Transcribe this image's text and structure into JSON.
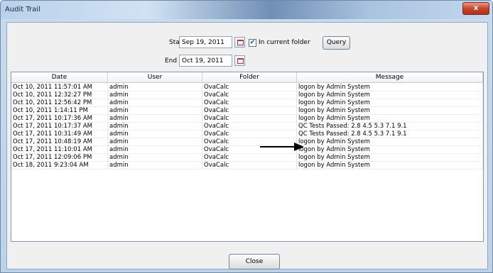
{
  "window": {
    "title": "Audit Trail",
    "close_glyph": "x"
  },
  "filters": {
    "start_label": "Start",
    "start_value": "Sep 19, 2011",
    "end_label": "End",
    "end_value": "Oct 19, 2011",
    "in_folder_label": "In current folder",
    "in_folder_checked": true,
    "query_label": "Query"
  },
  "table": {
    "columns": [
      "Date",
      "User",
      "Folder",
      "Message"
    ],
    "rows": [
      [
        "Oct 10, 2011 11:57:01 AM",
        "admin",
        "OvaCalc",
        "logon by Admin System"
      ],
      [
        "Oct 10, 2011 12:32:27 PM",
        "admin",
        "OvaCalc",
        "logon by Admin System"
      ],
      [
        "Oct 10, 2011 12:56:42 PM",
        "admin",
        "OvaCalc",
        "logon by Admin System"
      ],
      [
        "Oct 10, 2011 1:14:11 PM",
        "admin",
        "OvaCalc",
        "logon by Admin System"
      ],
      [
        "Oct 17, 2011 10:17:36 AM",
        "admin",
        "OvaCalc",
        "logon by Admin System"
      ],
      [
        "Oct 17, 2011 10:17:37 AM",
        "admin",
        "OvaCalc",
        "QC Tests Passed: 2.8 4.5 5.3 7.1 9.1"
      ],
      [
        "Oct 17, 2011 10:31:49 AM",
        "admin",
        "OvaCalc",
        "QC Tests Passed: 2.8 4.5 5.3 7.1 9.1"
      ],
      [
        "Oct 17, 2011 10:48:19 AM",
        "admin",
        "OvaCalc",
        "logon by Admin System"
      ],
      [
        "Oct 17, 2011 11:10:01 AM",
        "admin",
        "OvaCalc",
        "logon by Admin System"
      ],
      [
        "Oct 17, 2011 12:09:06 PM",
        "admin",
        "OvaCalc",
        "logon by Admin System"
      ],
      [
        "Oct 18, 2011 9:23:04 AM",
        "admin",
        "OvaCalc",
        "logon by Admin System"
      ]
    ]
  },
  "footer": {
    "close_label": "Close"
  },
  "icons": {
    "calendar": "calendar-icon",
    "arrow": "arrow-right-icon"
  }
}
